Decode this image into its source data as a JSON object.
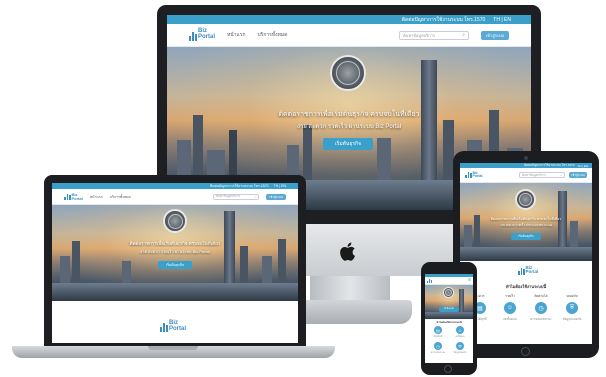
{
  "site": {
    "topbar_text": "ติดต่อปัญหาการใช้งานระบบ โทร.1570",
    "topbar_lang": "TH | EN",
    "logo_line1": "Biz",
    "logo_line2": "Portal",
    "nav_home": "หน้าแรก",
    "nav_services": "บริการทั้งหมด",
    "search_placeholder": "ค้นหาข้อมูลบริการ",
    "login_button": "เข้าสู่ระบบ",
    "hero_line1": "ติดต่อราชการเพื่อเริ่มต้นธุรกิจ ครบจบในที่เดียว",
    "hero_line2": "ง่าย สะดวก รวดเร็ว ผ่านระบบ Biz Portal",
    "hero_button": "เริ่มต้นธุรกิจ",
    "section_title": "ทำไมต้องใช้งานระบบนี้",
    "features": [
      {
        "label": "สะดวก",
        "desc": "ยื่นได้ทุกที่",
        "icon": "doc-icon"
      },
      {
        "label": "รวดเร็ว",
        "desc": "ลดขั้นตอน",
        "icon": "people-icon"
      },
      {
        "label": "ติดตามได้",
        "desc": "ตรวจสอบสถานะ",
        "icon": "clock-icon"
      },
      {
        "label": "ปลอดภัย",
        "desc": "ข้อมูลปลอดภัย",
        "icon": "shield-icon"
      }
    ]
  },
  "devices": {
    "brand_icon": "apple-logo-icon"
  },
  "colors": {
    "accent": "#3a9fc9",
    "frame": "#1d1f22",
    "silver": "#c9ccd0"
  }
}
